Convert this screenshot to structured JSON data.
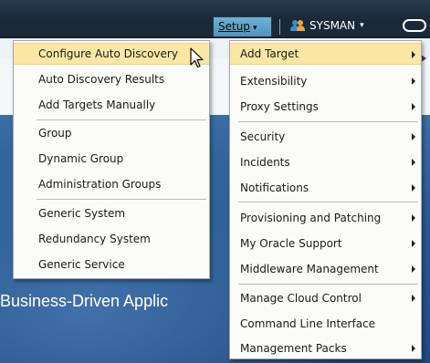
{
  "header": {
    "setup_label": "Setup",
    "setup_caret": "▾",
    "user_label": "SYSMAN",
    "user_caret": "▾"
  },
  "background": {
    "heading": "Business-Driven Applic"
  },
  "left_menu": {
    "items": [
      {
        "label": "Configure Auto Discovery",
        "highlighted": true
      },
      {
        "label": "Auto Discovery Results"
      },
      {
        "label": "Add Targets Manually"
      },
      {
        "label": "Group"
      },
      {
        "label": "Dynamic Group"
      },
      {
        "label": "Administration Groups"
      },
      {
        "label": "Generic System"
      },
      {
        "label": "Redundancy System"
      },
      {
        "label": "Generic Service"
      }
    ]
  },
  "right_menu": {
    "items": [
      {
        "label": "Add Target",
        "submenu": true,
        "highlighted": true
      },
      {
        "label": "Extensibility",
        "submenu": true
      },
      {
        "label": "Proxy Settings",
        "submenu": true
      },
      {
        "label": "Security",
        "submenu": true
      },
      {
        "label": "Incidents",
        "submenu": true
      },
      {
        "label": "Notifications",
        "submenu": true
      },
      {
        "label": "Provisioning and Patching",
        "submenu": true
      },
      {
        "label": "My Oracle Support",
        "submenu": true
      },
      {
        "label": "Middleware Management",
        "submenu": true
      },
      {
        "label": "Manage Cloud Control",
        "submenu": true
      },
      {
        "label": "Command Line Interface",
        "submenu": false
      },
      {
        "label": "Management Packs",
        "submenu": true
      }
    ]
  },
  "colors": {
    "highlight": "#fbe7a5",
    "setup_button": "#5ea3c9",
    "topbar": "#1d2c3d",
    "background_blue": "#2a5a92"
  },
  "icons": {
    "user": "user-icon",
    "power": "power-icon",
    "cursor": "mouse-pointer-icon"
  }
}
